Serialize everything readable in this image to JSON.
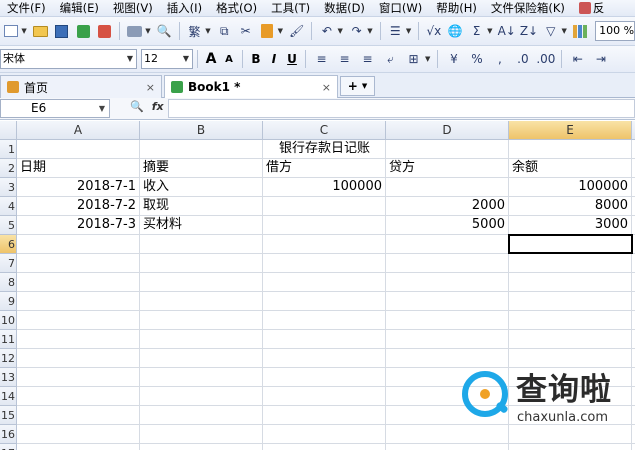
{
  "menubar": {
    "items": [
      "文件(F)",
      "编辑(E)",
      "视图(V)",
      "插入(I)",
      "格式(O)",
      "工具(T)",
      "数据(D)",
      "窗口(W)",
      "帮助(H)",
      "文件保险箱(K)"
    ],
    "feedback_label": "反"
  },
  "toolbar1": {
    "zoom": "100 %",
    "icons": [
      "new-icon",
      "open-folder-icon",
      "save-icon",
      "export-icon",
      "pdf-icon",
      "print-icon",
      "print-preview-icon",
      "traditional-chinese-icon",
      "copy-icon",
      "cut-icon",
      "paste-icon",
      "format-painter-icon",
      "undo-icon",
      "redo-icon",
      "row-col-icon",
      "function-icon",
      "hyperlink-icon",
      "sum-icon",
      "sort-asc-icon",
      "sort-desc-icon",
      "filter-icon",
      "chart-icon"
    ],
    "traditional_label": "繁",
    "sum_label": "Σ"
  },
  "toolbar2": {
    "font_name": "宋体",
    "font_size": "12",
    "grow_font_label": "A",
    "shrink_font_label": "A",
    "bold_label": "B",
    "italic_label": "I",
    "underline_label": "U",
    "percent_label": "%",
    "comma_label": ","
  },
  "tabs": {
    "home_label": "首页",
    "book_label": "Book1 *",
    "close_glyph": "×",
    "new_glyph": "+"
  },
  "formula_bar": {
    "name_box": "E6",
    "fx_label": "fx",
    "formula_value": ""
  },
  "sheet": {
    "columns": [
      "A",
      "B",
      "C",
      "D",
      "E"
    ],
    "active_column": "E",
    "row_numbers": [
      "1",
      "2",
      "3",
      "4",
      "5",
      "6",
      "7",
      "8",
      "9",
      "10",
      "11",
      "12",
      "13",
      "14",
      "15",
      "16",
      "17"
    ],
    "active_row": "6",
    "title": "银行存款日记账",
    "headers": [
      "日期",
      "摘要",
      "借方",
      "贷方",
      "余额"
    ],
    "rows": [
      {
        "date": "2018-7-1",
        "summary": "收入",
        "debit": "100000",
        "credit": "",
        "balance": "100000"
      },
      {
        "date": "2018-7-2",
        "summary": "取现",
        "debit": "",
        "credit": "2000",
        "balance": "8000"
      },
      {
        "date": "2018-7-3",
        "summary": "买材料",
        "debit": "",
        "credit": "5000",
        "balance": "3000"
      }
    ]
  },
  "watermark": {
    "title": "查询啦",
    "domain": "chaxunla.com"
  },
  "colors": {
    "accent": "#1ea8e8",
    "header_active": "#eec36a",
    "grid_line": "#d6dbe3"
  }
}
